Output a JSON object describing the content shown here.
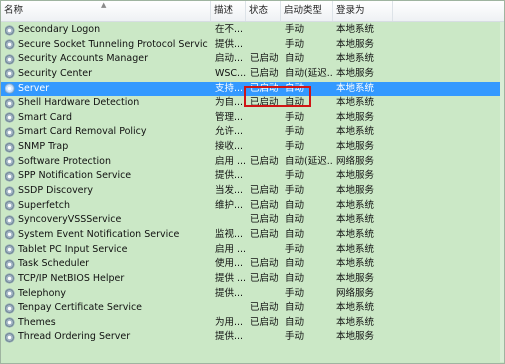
{
  "columns": {
    "name": "名称",
    "desc": "描述",
    "status": "状态",
    "type": "启动类型",
    "logon": "登录为"
  },
  "services": [
    {
      "name": "Secondary Logon",
      "desc": "在不...",
      "status": "",
      "type": "手动",
      "logon": "本地系统"
    },
    {
      "name": "Secure Socket Tunneling Protocol Service",
      "desc": "提供...",
      "status": "",
      "type": "手动",
      "logon": "本地服务"
    },
    {
      "name": "Security Accounts Manager",
      "desc": "启动...",
      "status": "已启动",
      "type": "自动",
      "logon": "本地系统"
    },
    {
      "name": "Security Center",
      "desc": "WSC...",
      "status": "已启动",
      "type": "自动(延迟...",
      "logon": "本地服务"
    },
    {
      "name": "Server",
      "desc": "支持...",
      "status": "已启动",
      "type": "自动",
      "logon": "本地系统"
    },
    {
      "name": "Shell Hardware Detection",
      "desc": "为自...",
      "status": "已启动",
      "type": "自动",
      "logon": "本地系统"
    },
    {
      "name": "Smart Card",
      "desc": "管理...",
      "status": "",
      "type": "手动",
      "logon": "本地服务"
    },
    {
      "name": "Smart Card Removal Policy",
      "desc": "允许...",
      "status": "",
      "type": "手动",
      "logon": "本地系统"
    },
    {
      "name": "SNMP Trap",
      "desc": "接收...",
      "status": "",
      "type": "手动",
      "logon": "本地服务"
    },
    {
      "name": "Software Protection",
      "desc": "启用 ...",
      "status": "已启动",
      "type": "自动(延迟...",
      "logon": "网络服务"
    },
    {
      "name": "SPP Notification Service",
      "desc": "提供...",
      "status": "",
      "type": "手动",
      "logon": "本地服务"
    },
    {
      "name": "SSDP Discovery",
      "desc": "当发...",
      "status": "已启动",
      "type": "手动",
      "logon": "本地服务"
    },
    {
      "name": "Superfetch",
      "desc": "维护...",
      "status": "已启动",
      "type": "自动",
      "logon": "本地系统"
    },
    {
      "name": "SyncoveryVSSService",
      "desc": "",
      "status": "已启动",
      "type": "自动",
      "logon": "本地系统"
    },
    {
      "name": "System Event Notification Service",
      "desc": "监视...",
      "status": "已启动",
      "type": "自动",
      "logon": "本地系统"
    },
    {
      "name": "Tablet PC Input Service",
      "desc": "启用 ...",
      "status": "",
      "type": "手动",
      "logon": "本地系统"
    },
    {
      "name": "Task Scheduler",
      "desc": "使用...",
      "status": "已启动",
      "type": "自动",
      "logon": "本地系统"
    },
    {
      "name": "TCP/IP NetBIOS Helper",
      "desc": "提供 ...",
      "status": "已启动",
      "type": "自动",
      "logon": "本地服务"
    },
    {
      "name": "Telephony",
      "desc": "提供...",
      "status": "",
      "type": "手动",
      "logon": "网络服务"
    },
    {
      "name": "Tenpay Certificate Service",
      "desc": "",
      "status": "已启动",
      "type": "自动",
      "logon": "本地系统"
    },
    {
      "name": "Themes",
      "desc": "为用...",
      "status": "已启动",
      "type": "自动",
      "logon": "本地系统"
    },
    {
      "name": "Thread Ordering Server",
      "desc": "提供...",
      "status": "",
      "type": "手动",
      "logon": "本地服务"
    }
  ],
  "selected_service": "Server"
}
